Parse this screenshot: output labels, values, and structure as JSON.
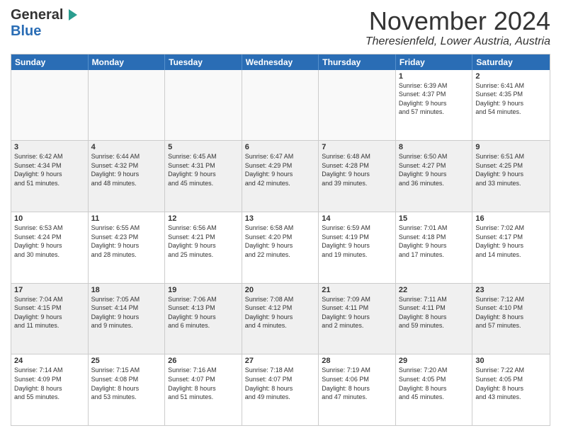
{
  "header": {
    "logo_general": "General",
    "logo_blue": "Blue",
    "month_title": "November 2024",
    "location": "Theresienfeld, Lower Austria, Austria"
  },
  "weekdays": [
    "Sunday",
    "Monday",
    "Tuesday",
    "Wednesday",
    "Thursday",
    "Friday",
    "Saturday"
  ],
  "weeks": [
    [
      {
        "day": "",
        "info": ""
      },
      {
        "day": "",
        "info": ""
      },
      {
        "day": "",
        "info": ""
      },
      {
        "day": "",
        "info": ""
      },
      {
        "day": "",
        "info": ""
      },
      {
        "day": "1",
        "info": "Sunrise: 6:39 AM\nSunset: 4:37 PM\nDaylight: 9 hours\nand 57 minutes."
      },
      {
        "day": "2",
        "info": "Sunrise: 6:41 AM\nSunset: 4:35 PM\nDaylight: 9 hours\nand 54 minutes."
      }
    ],
    [
      {
        "day": "3",
        "info": "Sunrise: 6:42 AM\nSunset: 4:34 PM\nDaylight: 9 hours\nand 51 minutes."
      },
      {
        "day": "4",
        "info": "Sunrise: 6:44 AM\nSunset: 4:32 PM\nDaylight: 9 hours\nand 48 minutes."
      },
      {
        "day": "5",
        "info": "Sunrise: 6:45 AM\nSunset: 4:31 PM\nDaylight: 9 hours\nand 45 minutes."
      },
      {
        "day": "6",
        "info": "Sunrise: 6:47 AM\nSunset: 4:29 PM\nDaylight: 9 hours\nand 42 minutes."
      },
      {
        "day": "7",
        "info": "Sunrise: 6:48 AM\nSunset: 4:28 PM\nDaylight: 9 hours\nand 39 minutes."
      },
      {
        "day": "8",
        "info": "Sunrise: 6:50 AM\nSunset: 4:27 PM\nDaylight: 9 hours\nand 36 minutes."
      },
      {
        "day": "9",
        "info": "Sunrise: 6:51 AM\nSunset: 4:25 PM\nDaylight: 9 hours\nand 33 minutes."
      }
    ],
    [
      {
        "day": "10",
        "info": "Sunrise: 6:53 AM\nSunset: 4:24 PM\nDaylight: 9 hours\nand 30 minutes."
      },
      {
        "day": "11",
        "info": "Sunrise: 6:55 AM\nSunset: 4:23 PM\nDaylight: 9 hours\nand 28 minutes."
      },
      {
        "day": "12",
        "info": "Sunrise: 6:56 AM\nSunset: 4:21 PM\nDaylight: 9 hours\nand 25 minutes."
      },
      {
        "day": "13",
        "info": "Sunrise: 6:58 AM\nSunset: 4:20 PM\nDaylight: 9 hours\nand 22 minutes."
      },
      {
        "day": "14",
        "info": "Sunrise: 6:59 AM\nSunset: 4:19 PM\nDaylight: 9 hours\nand 19 minutes."
      },
      {
        "day": "15",
        "info": "Sunrise: 7:01 AM\nSunset: 4:18 PM\nDaylight: 9 hours\nand 17 minutes."
      },
      {
        "day": "16",
        "info": "Sunrise: 7:02 AM\nSunset: 4:17 PM\nDaylight: 9 hours\nand 14 minutes."
      }
    ],
    [
      {
        "day": "17",
        "info": "Sunrise: 7:04 AM\nSunset: 4:15 PM\nDaylight: 9 hours\nand 11 minutes."
      },
      {
        "day": "18",
        "info": "Sunrise: 7:05 AM\nSunset: 4:14 PM\nDaylight: 9 hours\nand 9 minutes."
      },
      {
        "day": "19",
        "info": "Sunrise: 7:06 AM\nSunset: 4:13 PM\nDaylight: 9 hours\nand 6 minutes."
      },
      {
        "day": "20",
        "info": "Sunrise: 7:08 AM\nSunset: 4:12 PM\nDaylight: 9 hours\nand 4 minutes."
      },
      {
        "day": "21",
        "info": "Sunrise: 7:09 AM\nSunset: 4:11 PM\nDaylight: 9 hours\nand 2 minutes."
      },
      {
        "day": "22",
        "info": "Sunrise: 7:11 AM\nSunset: 4:11 PM\nDaylight: 8 hours\nand 59 minutes."
      },
      {
        "day": "23",
        "info": "Sunrise: 7:12 AM\nSunset: 4:10 PM\nDaylight: 8 hours\nand 57 minutes."
      }
    ],
    [
      {
        "day": "24",
        "info": "Sunrise: 7:14 AM\nSunset: 4:09 PM\nDaylight: 8 hours\nand 55 minutes."
      },
      {
        "day": "25",
        "info": "Sunrise: 7:15 AM\nSunset: 4:08 PM\nDaylight: 8 hours\nand 53 minutes."
      },
      {
        "day": "26",
        "info": "Sunrise: 7:16 AM\nSunset: 4:07 PM\nDaylight: 8 hours\nand 51 minutes."
      },
      {
        "day": "27",
        "info": "Sunrise: 7:18 AM\nSunset: 4:07 PM\nDaylight: 8 hours\nand 49 minutes."
      },
      {
        "day": "28",
        "info": "Sunrise: 7:19 AM\nSunset: 4:06 PM\nDaylight: 8 hours\nand 47 minutes."
      },
      {
        "day": "29",
        "info": "Sunrise: 7:20 AM\nSunset: 4:05 PM\nDaylight: 8 hours\nand 45 minutes."
      },
      {
        "day": "30",
        "info": "Sunrise: 7:22 AM\nSunset: 4:05 PM\nDaylight: 8 hours\nand 43 minutes."
      }
    ]
  ]
}
